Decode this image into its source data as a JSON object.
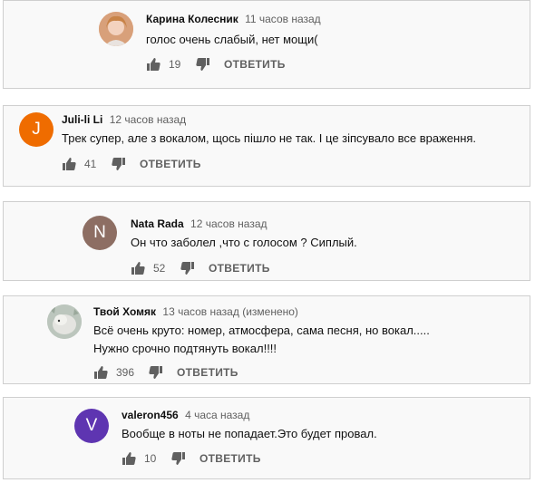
{
  "comments": [
    {
      "author": "Карина Колесник",
      "time": "11 часов назад",
      "lines": [
        "голос очень слабый, нет мощи("
      ],
      "likes": "19",
      "reply": "ОТВЕТИТЬ",
      "avatar_letter": "",
      "avatar_color": "#e8b38f"
    },
    {
      "author": "Juli-li Li",
      "time": "12 часов назад",
      "lines": [
        "Трек супер, але з вокалом, щось пішло не так. І це зіпсувало все враження."
      ],
      "likes": "41",
      "reply": "ОТВЕТИТЬ",
      "avatar_letter": "J",
      "avatar_color": "#ef6c00"
    },
    {
      "author": "Nata Rada",
      "time": "12 часов назад",
      "lines": [
        "Он что заболел ,что с голосом ? Сиплый."
      ],
      "likes": "52",
      "reply": "ОТВЕТИТЬ",
      "avatar_letter": "N",
      "avatar_color": "#8d6e63"
    },
    {
      "author": "Твой Хомяк",
      "time": "13 часов назад (изменено)",
      "lines": [
        "Всё очень круто: номер, атмосфера, сама песня, но вокал.....",
        "Нужно срочно подтянуть вокал!!!!"
      ],
      "likes": "396",
      "reply": "ОТВЕТИТЬ",
      "avatar_letter": "",
      "avatar_color": "#c8cfc8"
    },
    {
      "author": "valeron456",
      "time": "4 часа назад",
      "lines": [
        "Вообще в ноты не попадает.Это будет провал."
      ],
      "likes": "10",
      "reply": "ОТВЕТИТЬ",
      "avatar_letter": "V",
      "avatar_color": "#5e35b1"
    }
  ]
}
